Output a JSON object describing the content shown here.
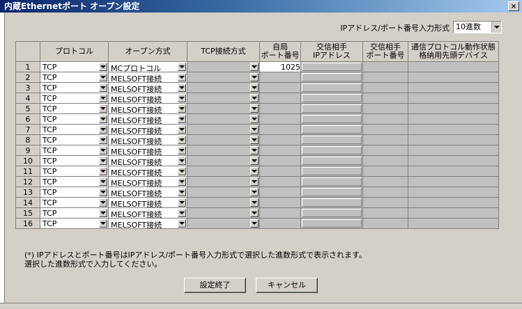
{
  "window": {
    "title": "内蔵Ethernetポート オープン設定",
    "close_label": "×"
  },
  "format": {
    "label": "IPアドレス/ポート番号入力形式",
    "value": "10進数"
  },
  "table": {
    "headers": [
      "プロトコル",
      "オープン方式",
      "TCP接続方式",
      "自局\nポート番号",
      "交信相手\nIPアドレス",
      "交信相手\nポート番号",
      "通信プロトコル動作状態\n格納用先頭デバイス"
    ],
    "rows": [
      {
        "n": "1",
        "protocol": "TCP",
        "open": "MCプロトコル",
        "port": "1025"
      },
      {
        "n": "2",
        "protocol": "TCP",
        "open": "MELSOFT接続",
        "port": ""
      },
      {
        "n": "3",
        "protocol": "TCP",
        "open": "MELSOFT接続",
        "port": ""
      },
      {
        "n": "4",
        "protocol": "TCP",
        "open": "MELSOFT接続",
        "port": ""
      },
      {
        "n": "5",
        "protocol": "TCP",
        "open": "MELSOFT接続",
        "port": ""
      },
      {
        "n": "6",
        "protocol": "TCP",
        "open": "MELSOFT接続",
        "port": ""
      },
      {
        "n": "7",
        "protocol": "TCP",
        "open": "MELSOFT接続",
        "port": ""
      },
      {
        "n": "8",
        "protocol": "TCP",
        "open": "MELSOFT接続",
        "port": ""
      },
      {
        "n": "9",
        "protocol": "TCP",
        "open": "MELSOFT接続",
        "port": ""
      },
      {
        "n": "10",
        "protocol": "TCP",
        "open": "MELSOFT接続",
        "port": ""
      },
      {
        "n": "11",
        "protocol": "TCP",
        "open": "MELSOFT接続",
        "port": ""
      },
      {
        "n": "12",
        "protocol": "TCP",
        "open": "MELSOFT接続",
        "port": ""
      },
      {
        "n": "13",
        "protocol": "TCP",
        "open": "MELSOFT接続",
        "port": ""
      },
      {
        "n": "14",
        "protocol": "TCP",
        "open": "MELSOFT接続",
        "port": ""
      },
      {
        "n": "15",
        "protocol": "TCP",
        "open": "MELSOFT接続",
        "port": ""
      },
      {
        "n": "16",
        "protocol": "TCP",
        "open": "MELSOFT接続",
        "port": ""
      }
    ]
  },
  "note": "(*) IPアドレスとポート番号はIPアドレス/ポート番号入力形式で選択した進数形式で表示されます。\n選択した進数形式で入力してください。",
  "buttons": {
    "ok": "設定終了",
    "cancel": "キャンセル"
  }
}
